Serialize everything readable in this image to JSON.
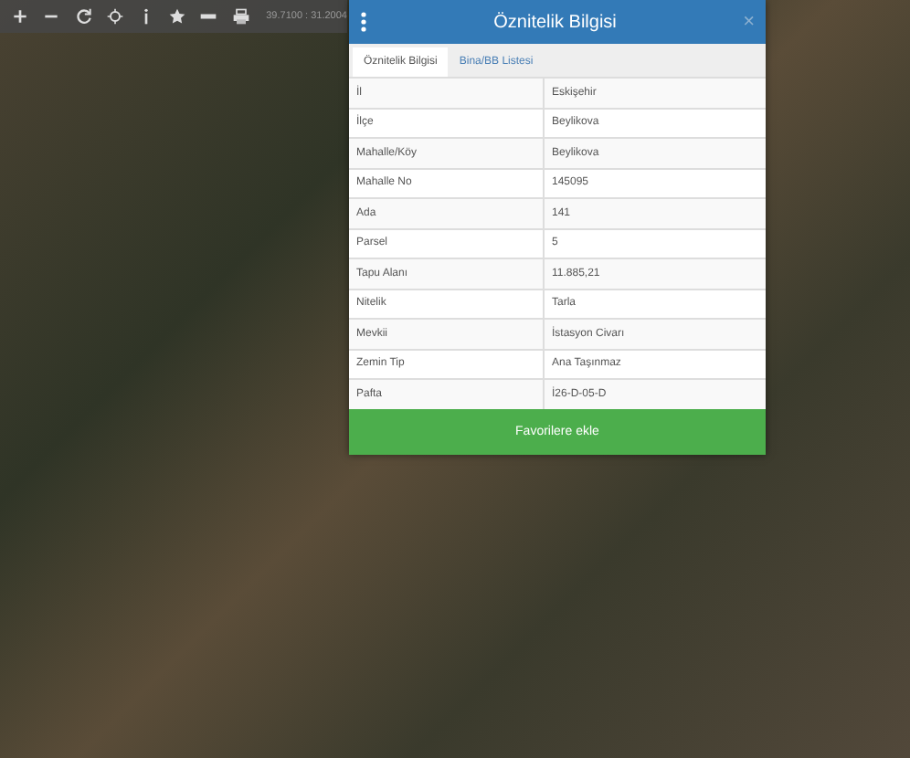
{
  "toolbar": {
    "coordinates": "39.7100 : 31.2004"
  },
  "dialog": {
    "title": "Öznitelik Bilgisi",
    "close": "×",
    "tabs": [
      {
        "label": "Öznitelik Bilgisi",
        "selected": true
      },
      {
        "label": "Bina/BB Listesi",
        "selected": false
      }
    ],
    "rows": [
      {
        "label": "İl",
        "value": "Eskişehir"
      },
      {
        "label": "İlçe",
        "value": "Beylikova"
      },
      {
        "label": "Mahalle/Köy",
        "value": "Beylikova"
      },
      {
        "label": "Mahalle No",
        "value": "145095"
      },
      {
        "label": "Ada",
        "value": "141"
      },
      {
        "label": "Parsel",
        "value": "5"
      },
      {
        "label": "Tapu Alanı",
        "value": "11.885,21"
      },
      {
        "label": "Nitelik",
        "value": "Tarla"
      },
      {
        "label": "Mevkii",
        "value": "İstasyon Civarı"
      },
      {
        "label": "Zemin Tip",
        "value": "Ana Taşınmaz"
      },
      {
        "label": "Pafta",
        "value": "İ26-D-05-D"
      }
    ],
    "button": "Favorilere ekle"
  }
}
